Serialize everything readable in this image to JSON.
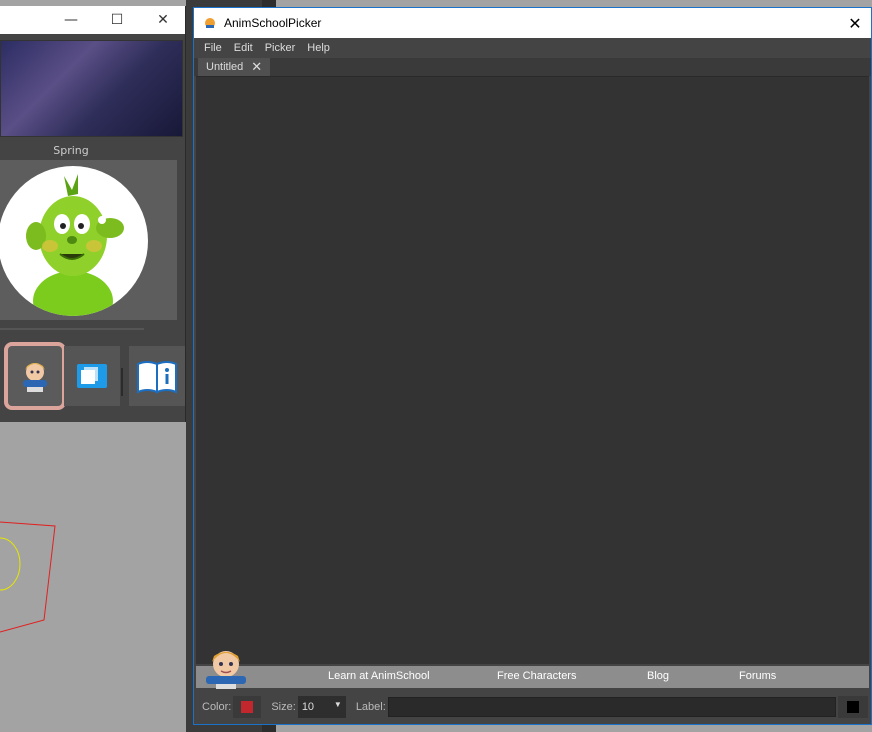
{
  "left_window": {
    "minimize_glyph": "—",
    "maximize_glyph": "☐",
    "close_glyph": "✕",
    "character_label": "Spring",
    "tools": [
      {
        "icon": "animschool-logo-icon"
      },
      {
        "icon": "copy-window-icon"
      },
      {
        "icon": "info-book-icon"
      }
    ]
  },
  "picker": {
    "title": "AnimSchoolPicker",
    "close_glyph": "✕",
    "menu": [
      "File",
      "Edit",
      "Picker",
      "Help"
    ],
    "tabs": [
      {
        "label": "Untitled",
        "close_glyph": "✕"
      }
    ],
    "links": [
      "Learn at AnimSchool",
      "Free Characters",
      "Blog",
      "Forums"
    ],
    "bottom": {
      "color_label": "Color:",
      "color_value": "#c1272d",
      "size_label": "Size:",
      "size_value": "10",
      "label_label": "Label:",
      "label_value": "",
      "label_color": "#000000"
    }
  },
  "colors": {
    "accent_border": "#1a73c9",
    "selected_tool_border": "#dba59c"
  }
}
